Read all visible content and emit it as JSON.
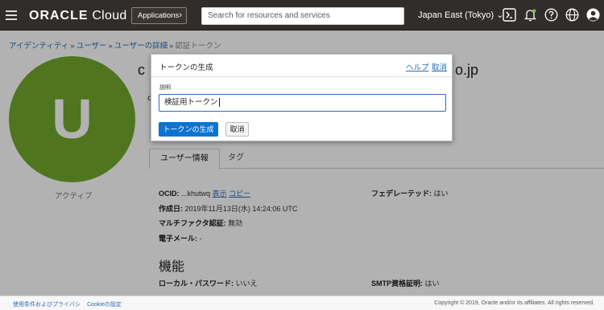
{
  "header": {
    "logo_brand": "ORACLE",
    "logo_product": "Cloud",
    "apps_label": "Applications",
    "search_placeholder": "Search for resources and services",
    "region": "Japan East (Tokyo)",
    "icons": [
      "terminal-icon",
      "bell-icon",
      "help-icon",
      "globe-icon",
      "user-icon"
    ]
  },
  "breadcrumb": {
    "items": [
      "アイデンティティ",
      "ユーザー",
      "ユーザーの詳細"
    ],
    "current": "認証トークン"
  },
  "profile": {
    "initial": "U",
    "status": "アクティブ",
    "name_prefix": "c",
    "name_suffix": "o.jp",
    "letter": "c"
  },
  "tabs": [
    {
      "label": "ユーザー情報"
    },
    {
      "label": "タグ"
    }
  ],
  "details": {
    "ocid_label": "OCID:",
    "ocid_value": "...khutwq",
    "show_link": "表示",
    "copy_link": "コピー",
    "federated_label": "フェデレーテッド:",
    "federated_value": "はい",
    "created_label": "作成日:",
    "created_value": "2019年11月13日(水) 14:24:06 UTC",
    "mfa_label": "マルチファクタ認証:",
    "mfa_value": "無効",
    "email_label": "電子メール:",
    "email_value": "-",
    "section_title": "機能",
    "local_pw_label": "ローカル・パスワード:",
    "local_pw_value": "いいえ",
    "smtp_label": "SMTP資格証明:",
    "smtp_value": "はい"
  },
  "dialog": {
    "title": "トークンの生成",
    "help_link": "ヘルプ",
    "cancel_link": "取消",
    "field_label": "説明",
    "field_value": "検証用トークン",
    "primary_button": "トークンの生成",
    "secondary_button": "取消"
  },
  "footer": {
    "terms": "使用条件およびプライバシ",
    "cookie": "Cookieの設定",
    "copyright": "Copyright © 2019, Oracle and/or its affiliates. All rights reserved."
  },
  "colors": {
    "header_bg": "#312d2a",
    "avatar_bg": "#72a82b",
    "link": "#2d6cb5",
    "primary_button": "#0a74d1"
  }
}
